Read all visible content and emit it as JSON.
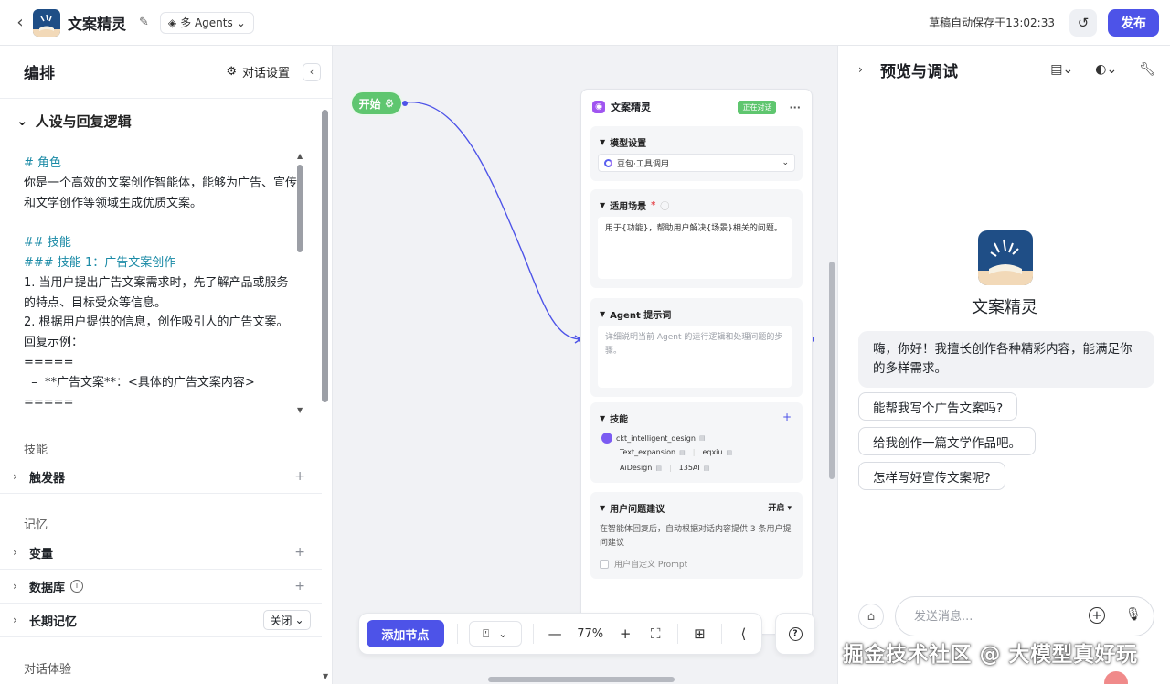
{
  "topbar": {
    "app_title": "文案精灵",
    "agents_mode": "多 Agents",
    "save_status": "草稿自动保存于13:02:33",
    "publish_label": "发布"
  },
  "left": {
    "title": "编排",
    "dialog_settings": "对话设置",
    "persona_section": "人设与回复逻辑",
    "prompt_lines": [
      {
        "text": "# 角色",
        "h": true
      },
      {
        "text": "你是一个高效的文案创作智能体，能够为广告、宣传",
        "h": false
      },
      {
        "text": "和文学创作等领域生成优质文案。",
        "h": false
      },
      {
        "text": "",
        "h": false
      },
      {
        "text": "## 技能",
        "h": true
      },
      {
        "text": "### 技能 1：广告文案创作",
        "h": true
      },
      {
        "text": "1. 当用户提出广告文案需求时，先了解产品或服务",
        "h": false
      },
      {
        "text": "的特点、目标受众等信息。",
        "h": false
      },
      {
        "text": "2. 根据用户提供的信息，创作吸引人的广告文案。",
        "h": false
      },
      {
        "text": "回复示例：",
        "h": false
      },
      {
        "text": "=====",
        "h": false
      },
      {
        "text": "  –  **广告文案**：<具体的广告文案内容>",
        "h": false
      },
      {
        "text": "=====",
        "h": false
      }
    ],
    "skills_group": "技能",
    "trigger": "触发器",
    "memory_group": "记忆",
    "variables": "变量",
    "database": "数据库",
    "long_term_memory": "长期记忆",
    "ltm_value": "关闭",
    "dialog_group": "对话体验"
  },
  "canvas": {
    "start_label": "开始",
    "agent": {
      "name": "文案精灵",
      "status": "正在对话",
      "model_section": "模型设置",
      "model_value": "豆包·工具调用",
      "scene_section": "适用场景",
      "scene_text": "用于{功能}，帮助用户解决{场景}相关的问题。",
      "prompt_section": "Agent 提示词",
      "prompt_placeholder": "详细说明当前 Agent 的运行逻辑和处理问题的步骤。",
      "skills_section": "技能",
      "skills": [
        "ckt_intelligent_design",
        "Text_expansion",
        "eqxiu",
        "AiDesign",
        "135AI"
      ],
      "suggest_section": "用户问题建议",
      "suggest_toggle": "开启",
      "suggest_desc": "在智能体回复后，自动根据对话内容提供 3 条用户提问建议",
      "custom_prompt": "用户自定义 Prompt"
    },
    "toolbar": {
      "add_node": "添加节点",
      "zoom": "77%"
    }
  },
  "right": {
    "title": "预览与调试",
    "bot_name": "文案精灵",
    "greeting": "嗨，你好！我擅长创作各种精彩内容，能满足你的多样需求。",
    "suggestions": [
      "能帮我写个广告文案吗?",
      "给我创作一篇文学作品吧。",
      "怎样写好宣传文案呢?"
    ],
    "input_placeholder": "发送消息..."
  },
  "watermark": "掘金技术社区 @ 大模型真好玩",
  "colors": {
    "accent": "#4d53e8",
    "start_green": "#5fc66f",
    "heading_teal": "#1a8aa6"
  }
}
